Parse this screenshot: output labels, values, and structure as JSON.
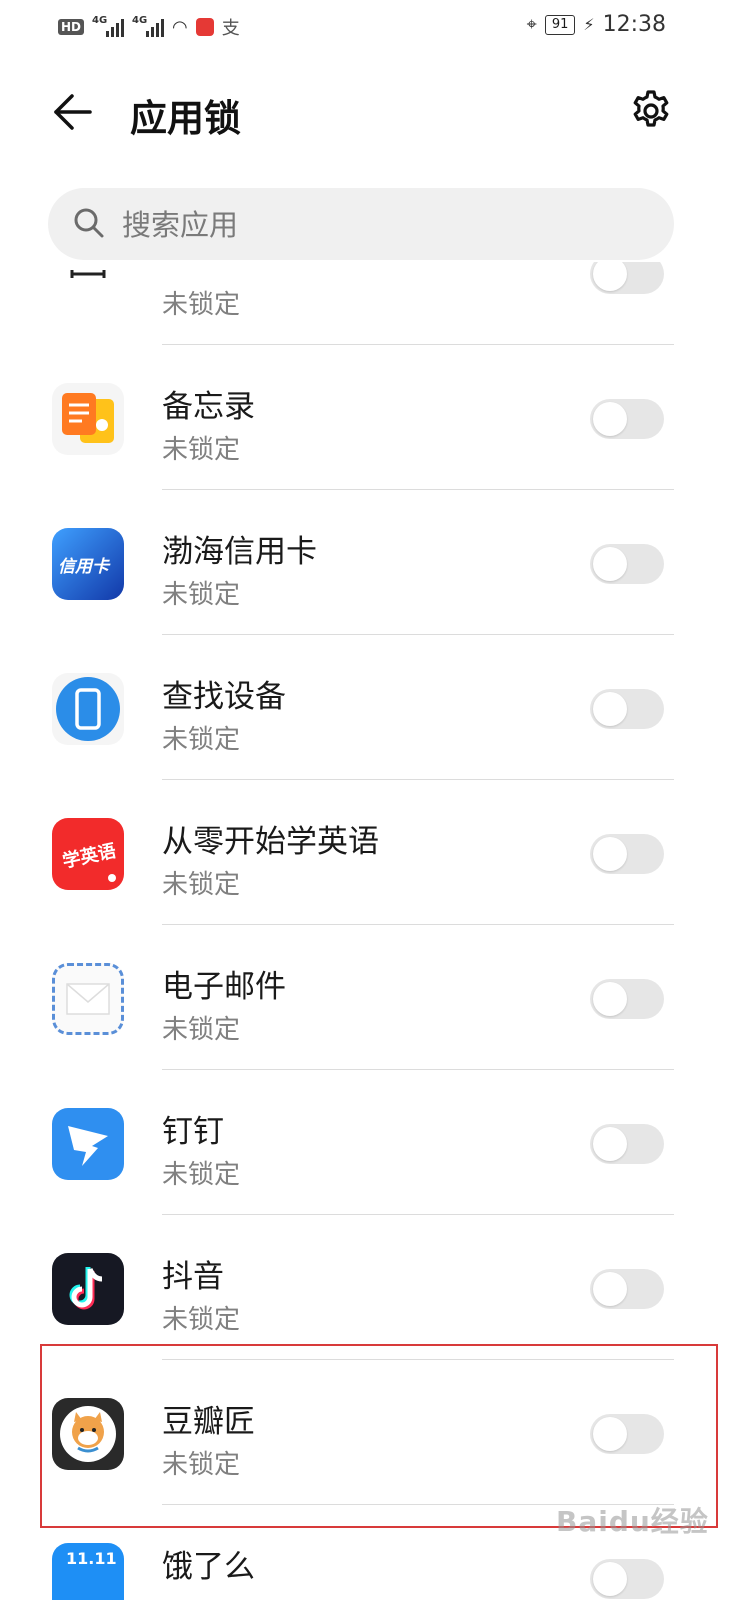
{
  "status_bar": {
    "hd": "HD",
    "net1": "4G",
    "net2": "4G",
    "battery": "91",
    "time": "12:38"
  },
  "header": {
    "title": "应用锁"
  },
  "search": {
    "placeholder": "搜索应用"
  },
  "apps": [
    {
      "name": "",
      "status": "未锁定",
      "locked": false,
      "icon": "ruler-icon",
      "color": "#ffffff"
    },
    {
      "name": "备忘录",
      "status": "未锁定",
      "locked": false,
      "icon": "notes-icon",
      "color": "#ff8a1f"
    },
    {
      "name": "渤海信用卡",
      "status": "未锁定",
      "locked": false,
      "icon": "credit-card-app-icon",
      "color": "#1e55c8",
      "icon_text": "信用卡"
    },
    {
      "name": "查找设备",
      "status": "未锁定",
      "locked": false,
      "icon": "find-device-icon",
      "color": "#2b8de8"
    },
    {
      "name": "从零开始学英语",
      "status": "未锁定",
      "locked": false,
      "icon": "learn-english-icon",
      "color": "#f22b2b",
      "icon_text": "学英语"
    },
    {
      "name": "电子邮件",
      "status": "未锁定",
      "locked": false,
      "icon": "email-icon",
      "color": "#f2f2f2"
    },
    {
      "name": "钉钉",
      "status": "未锁定",
      "locked": false,
      "icon": "dingtalk-icon",
      "color": "#2f8ff0"
    },
    {
      "name": "抖音",
      "status": "未锁定",
      "locked": false,
      "icon": "douyin-icon",
      "color": "#161823"
    },
    {
      "name": "豆瓣匠",
      "status": "未锁定",
      "locked": false,
      "icon": "doubanjiang-icon",
      "color": "#2a2a2a"
    },
    {
      "name": "饿了么",
      "status": "",
      "locked": false,
      "icon": "eleme-icon",
      "color": "#1e8ff5",
      "icon_text": "11.11"
    }
  ],
  "watermark": "Baidu经验"
}
